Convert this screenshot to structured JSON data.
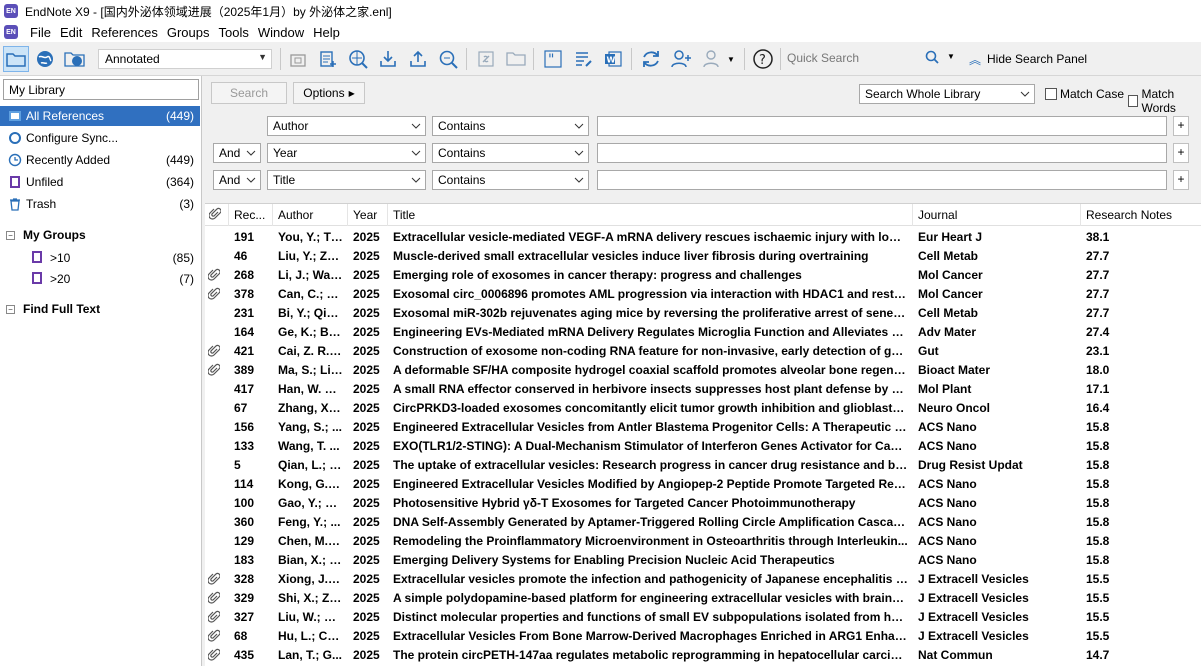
{
  "window": {
    "title": "EndNote X9 - [国内外泌体领域进展（2025年1月）by 外泌体之家.enl]",
    "app_icon": "EN"
  },
  "menu": [
    "File",
    "Edit",
    "References",
    "Groups",
    "Tools",
    "Window",
    "Help"
  ],
  "toolbar": {
    "style": "Annotated",
    "quick_search_placeholder": "Quick Search",
    "hide_panel_label": "Hide Search Panel"
  },
  "library": {
    "name": "My Library",
    "groups": [
      {
        "label": "All References",
        "count": "(449)",
        "icon": "all-references-icon"
      },
      {
        "label": "Configure Sync...",
        "count": "",
        "icon": "sync-icon"
      },
      {
        "label": "Recently Added",
        "count": "(449)",
        "icon": "clock-icon"
      },
      {
        "label": "Unfiled",
        "count": "(364)",
        "icon": "unfiled-icon"
      },
      {
        "label": "Trash",
        "count": "(3)",
        "icon": "trash-icon"
      }
    ],
    "my_groups_label": "My Groups",
    "my_groups": [
      {
        "label": ">10",
        "count": "(85)"
      },
      {
        "label": ">20",
        "count": "(7)"
      }
    ],
    "find_full_text_label": "Find Full Text"
  },
  "search": {
    "search_button": "Search",
    "options_button": "Options",
    "scope": "Search Whole Library",
    "match_case": "Match Case",
    "match_words": "Match Words",
    "rows": [
      {
        "bool": "",
        "field": "Author",
        "op": "Contains",
        "value": ""
      },
      {
        "bool": "And",
        "field": "Year",
        "op": "Contains",
        "value": ""
      },
      {
        "bool": "And",
        "field": "Title",
        "op": "Contains",
        "value": ""
      }
    ]
  },
  "columns": [
    "Rec...",
    "Author",
    "Year",
    "Title",
    "Journal",
    "Research Notes"
  ],
  "references": [
    {
      "clip": false,
      "rec": "191",
      "author": "You, Y.; Ti...",
      "year": "2025",
      "title": "Extracellular vesicle-mediated VEGF-A mRNA delivery rescues ischaemic injury with low im...",
      "journal": "Eur Heart J",
      "notes": "38.1"
    },
    {
      "clip": false,
      "rec": "46",
      "author": "Liu, Y.; Zh...",
      "year": "2025",
      "title": "Muscle-derived small extracellular vesicles induce liver fibrosis during overtraining",
      "journal": "Cell Metab",
      "notes": "27.7"
    },
    {
      "clip": true,
      "rec": "268",
      "author": "Li, J.; Wan...",
      "year": "2025",
      "title": "Emerging role of exosomes in cancer therapy: progress and challenges",
      "journal": "Mol Cancer",
      "notes": "27.7"
    },
    {
      "clip": true,
      "rec": "378",
      "author": "Can, C.; Ya...",
      "year": "2025",
      "title": "Exosomal circ_0006896 promotes AML progression via interaction with HDAC1 and restrict...",
      "journal": "Mol Cancer",
      "notes": "27.7"
    },
    {
      "clip": false,
      "rec": "231",
      "author": "Bi, Y.; Qia...",
      "year": "2025",
      "title": "Exosomal miR-302b rejuvenates aging mice by reversing the proliferative arrest of senesc...",
      "journal": "Cell Metab",
      "notes": "27.7"
    },
    {
      "clip": false,
      "rec": "164",
      "author": "Ge, K.; Ba...",
      "year": "2025",
      "title": "Engineering EVs-Mediated mRNA Delivery Regulates Microglia Function and Alleviates Dep...",
      "journal": "Adv Mater",
      "notes": "27.4"
    },
    {
      "clip": true,
      "rec": "421",
      "author": "Cai, Z. R.; ...",
      "year": "2025",
      "title": "Construction of exosome non-coding RNA feature for non-invasive, early detection of gast...",
      "journal": "Gut",
      "notes": "23.1"
    },
    {
      "clip": true,
      "rec": "389",
      "author": "Ma, S.; Li, ...",
      "year": "2025",
      "title": "A deformable SF/HA composite hydrogel coaxial scaffold promotes alveolar bone regener...",
      "journal": "Bioact Mater",
      "notes": "18.0"
    },
    {
      "clip": false,
      "rec": "417",
      "author": "Han, W. H...",
      "year": "2025",
      "title": "A small RNA effector conserved in herbivore insects suppresses host plant defense by cros...",
      "journal": "Mol Plant",
      "notes": "17.1"
    },
    {
      "clip": false,
      "rec": "67",
      "author": "Zhang, X.;...",
      "year": "2025",
      "title": "CircPRKD3-loaded exosomes concomitantly elicit tumor growth inhibition and glioblastom...",
      "journal": "Neuro Oncol",
      "notes": "16.4"
    },
    {
      "clip": false,
      "rec": "156",
      "author": "Yang, S.; ...",
      "year": "2025",
      "title": "Engineered Extracellular Vesicles from Antler Blastema Progenitor Cells: A Therapeutic Cho...",
      "journal": "ACS Nano",
      "notes": "15.8"
    },
    {
      "clip": false,
      "rec": "133",
      "author": "Wang, T. ...",
      "year": "2025",
      "title": "EXO(TLR1/2-STING): A Dual-Mechanism Stimulator of Interferon Genes Activator for Canc...",
      "journal": "ACS Nano",
      "notes": "15.8"
    },
    {
      "clip": false,
      "rec": "5",
      "author": "Qian, L.; C...",
      "year": "2025",
      "title": "The uptake of extracellular vesicles: Research progress in cancer drug resistance and beyond",
      "journal": "Drug Resist Updat",
      "notes": "15.8"
    },
    {
      "clip": false,
      "rec": "114",
      "author": "Kong, G.; ...",
      "year": "2025",
      "title": "Engineered Extracellular Vesicles Modified by Angiopep-2 Peptide Promote Targeted Repai...",
      "journal": "ACS Nano",
      "notes": "15.8"
    },
    {
      "clip": false,
      "rec": "100",
      "author": "Gao, Y.; Li...",
      "year": "2025",
      "title": "Photosensitive Hybrid γδ-T Exosomes for Targeted Cancer Photoimmunotherapy",
      "journal": "ACS Nano",
      "notes": "15.8"
    },
    {
      "clip": false,
      "rec": "360",
      "author": "Feng, Y.; ...",
      "year": "2025",
      "title": "DNA Self-Assembly Generated by Aptamer-Triggered Rolling Circle Amplification Cascades ...",
      "journal": "ACS Nano",
      "notes": "15.8"
    },
    {
      "clip": false,
      "rec": "129",
      "author": "Chen, M.; ...",
      "year": "2025",
      "title": "Remodeling the Proinflammatory Microenvironment in Osteoarthritis through Interleukin...",
      "journal": "ACS Nano",
      "notes": "15.8"
    },
    {
      "clip": false,
      "rec": "183",
      "author": "Bian, X.; Z...",
      "year": "2025",
      "title": "Emerging Delivery Systems for Enabling Precision Nucleic Acid Therapeutics",
      "journal": "ACS Nano",
      "notes": "15.8"
    },
    {
      "clip": true,
      "rec": "328",
      "author": "Xiong, J.; ...",
      "year": "2025",
      "title": "Extracellular vesicles promote the infection and pathogenicity of Japanese encephalitis virus",
      "journal": "J Extracell Vesicles",
      "notes": "15.5"
    },
    {
      "clip": true,
      "rec": "329",
      "author": "Shi, X.; Zh...",
      "year": "2025",
      "title": "A simple polydopamine-based platform for engineering extracellular vesicles with brain-ta...",
      "journal": "J Extracell Vesicles",
      "notes": "15.5"
    },
    {
      "clip": true,
      "rec": "327",
      "author": "Liu, W.; W...",
      "year": "2025",
      "title": "Distinct molecular properties and functions of small EV subpopulations isolated from huma...",
      "journal": "J Extracell Vesicles",
      "notes": "15.5"
    },
    {
      "clip": true,
      "rec": "68",
      "author": "Hu, L.; Ch...",
      "year": "2025",
      "title": "Extracellular Vesicles From Bone Marrow-Derived Macrophages Enriched in ARG1 Enhance ...",
      "journal": "J Extracell Vesicles",
      "notes": "15.5"
    },
    {
      "clip": true,
      "rec": "435",
      "author": "Lan, T.; G...",
      "year": "2025",
      "title": "The protein circPETH-147aa regulates metabolic reprogramming in hepatocellular carcino...",
      "journal": "Nat Commun",
      "notes": "14.7"
    }
  ],
  "colors": {
    "selection": "#3070c0",
    "accent": "#2a6fb8"
  }
}
